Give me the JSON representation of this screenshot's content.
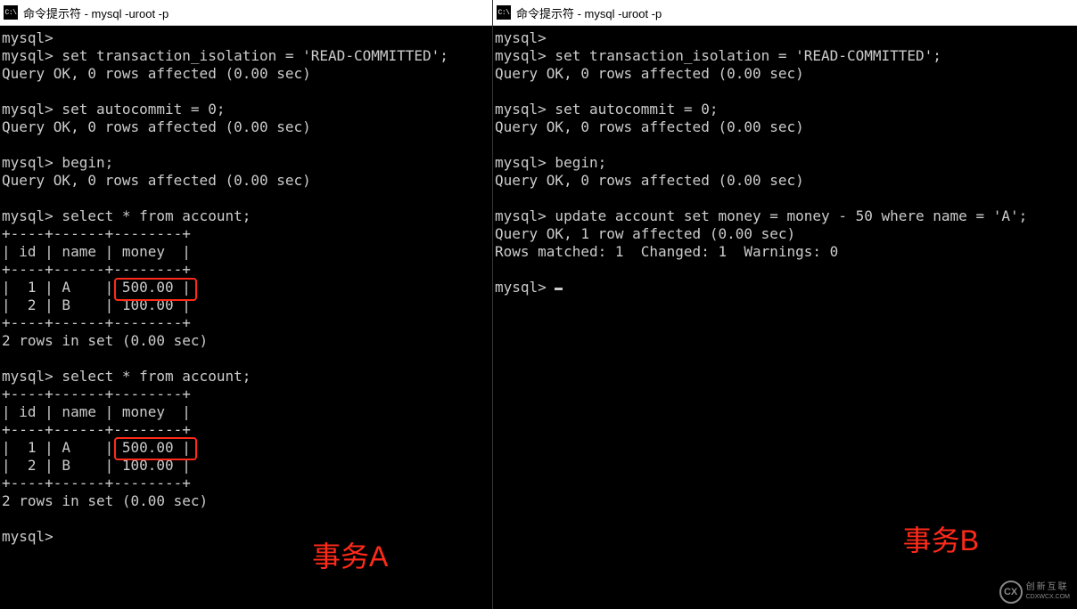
{
  "left": {
    "title": "命令提示符 - mysql  -uroot -p",
    "label": "事务A",
    "lines": [
      "mysql>",
      "mysql> set transaction_isolation = 'READ-COMMITTED';",
      "Query OK, 0 rows affected (0.00 sec)",
      "",
      "mysql> set autocommit = 0;",
      "Query OK, 0 rows affected (0.00 sec)",
      "",
      "mysql> begin;",
      "Query OK, 0 rows affected (0.00 sec)",
      "",
      "mysql> select * from account;"
    ],
    "table1": {
      "headers": [
        "id",
        "name",
        "money"
      ],
      "rows": [
        [
          "1",
          "A",
          "500.00"
        ],
        [
          "2",
          "B",
          "100.00"
        ]
      ],
      "footer": "2 rows in set (0.00 sec)"
    },
    "mid_lines": [
      "",
      "mysql> select * from account;"
    ],
    "table2": {
      "headers": [
        "id",
        "name",
        "money"
      ],
      "rows": [
        [
          "1",
          "A",
          "500.00"
        ],
        [
          "2",
          "B",
          "100.00"
        ]
      ],
      "footer": "2 rows in set (0.00 sec)"
    },
    "tail_lines": [
      "",
      "mysql>"
    ]
  },
  "right": {
    "title": "命令提示符 - mysql  -uroot -p",
    "label": "事务B",
    "lines": [
      "mysql>",
      "mysql> set transaction_isolation = 'READ-COMMITTED';",
      "Query OK, 0 rows affected (0.00 sec)",
      "",
      "mysql> set autocommit = 0;",
      "Query OK, 0 rows affected (0.00 sec)",
      "",
      "mysql> begin;",
      "Query OK, 0 rows affected (0.00 sec)",
      "",
      "mysql> update account set money = money - 50 where name = 'A';",
      "Query OK, 1 row affected (0.00 sec)",
      "Rows matched: 1  Changed: 1  Warnings: 0",
      "",
      "mysql> "
    ]
  },
  "watermark": {
    "brand_cn": "创新互联",
    "brand_en": "CDXWCX.COM"
  }
}
